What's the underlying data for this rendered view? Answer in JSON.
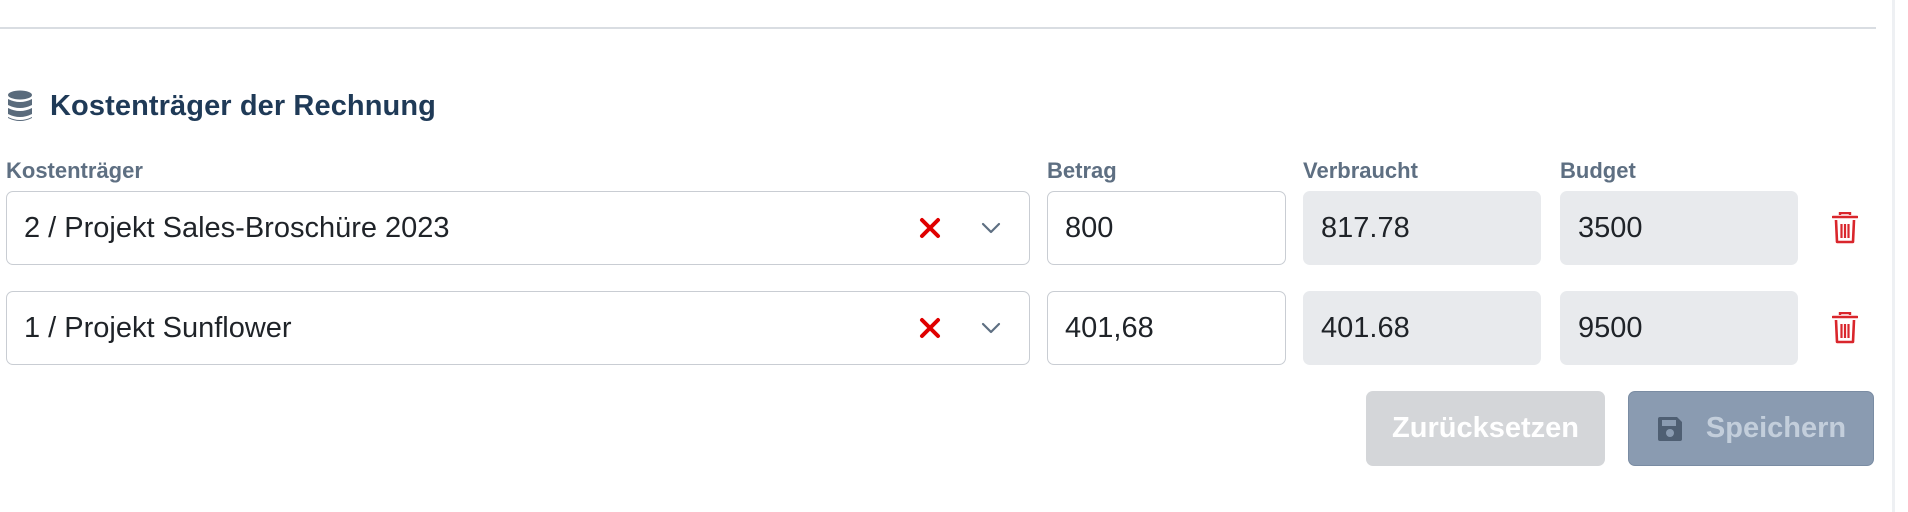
{
  "section": {
    "title": "Kostenträger der Rechnung",
    "icon": "database-icon"
  },
  "columns": {
    "kostentraeger": "Kostenträger",
    "betrag": "Betrag",
    "verbraucht": "Verbraucht",
    "budget": "Budget"
  },
  "rows": [
    {
      "kostentraeger": "2 / Projekt Sales-Broschüre 2023",
      "betrag": "800",
      "verbraucht": "817.78",
      "budget": "3500"
    },
    {
      "kostentraeger": "1 / Projekt Sunflower",
      "betrag": "401,68",
      "verbraucht": "401.68",
      "budget": "9500"
    }
  ],
  "actions": {
    "reset_label": "Zurücksetzen",
    "save_label": "Speichern"
  },
  "colors": {
    "title": "#1f3a57",
    "label": "#5e6f82",
    "clear": "#e00000",
    "trash": "#d9262c",
    "readonly_bg": "#e8eaed",
    "save_bg": "#8a9bb1",
    "reset_bg": "#d4d6d9"
  }
}
